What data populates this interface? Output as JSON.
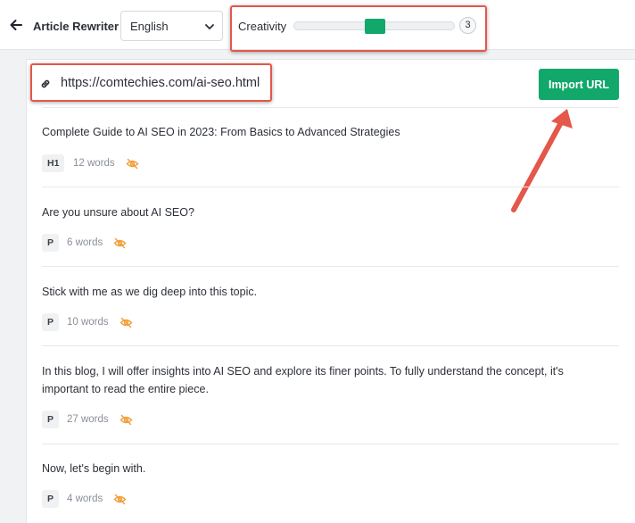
{
  "toolbar": {
    "title": "Article Rewriter",
    "language": "English",
    "creativity_label": "Creativity",
    "creativity_value": "3",
    "creativity_level_fraction": 0.5
  },
  "url_bar": {
    "url": "https://comtechies.com/ai-seo.html",
    "import_label": "Import URL"
  },
  "paragraphs": [
    {
      "tag": "H1",
      "text": "Complete Guide to AI SEO in 2023: From Basics to Advanced Strategies",
      "words": "12 words"
    },
    {
      "tag": "P",
      "text": "Are you unsure about AI SEO?",
      "words": "6 words"
    },
    {
      "tag": "P",
      "text": "Stick with me as we dig deep into this topic.",
      "words": "10 words"
    },
    {
      "tag": "P",
      "text": "In this blog, I will offer insights into AI SEO and explore its finer points. To fully understand the concept, it's important to read the entire piece.",
      "words": "27 words"
    },
    {
      "tag": "P",
      "text": "Now, let's begin with.",
      "words": "4 words"
    }
  ],
  "colors": {
    "accent_green": "#12a86b",
    "highlight_red": "#e4574a",
    "hide_icon_orange": "#f0a03c"
  },
  "icons": {
    "back": "arrow-left-icon",
    "language_dropdown": "chevron-down-icon",
    "url": "link-icon",
    "visibility": "eye-off-icon"
  }
}
